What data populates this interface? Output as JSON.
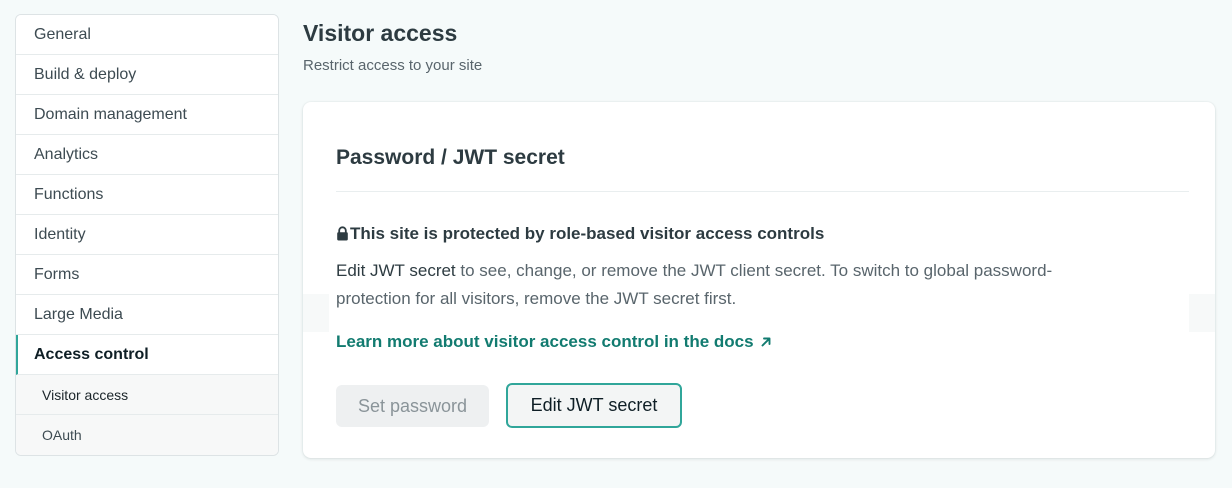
{
  "sidebar": {
    "items": [
      {
        "label": "General"
      },
      {
        "label": "Build & deploy"
      },
      {
        "label": "Domain management"
      },
      {
        "label": "Analytics"
      },
      {
        "label": "Functions"
      },
      {
        "label": "Identity"
      },
      {
        "label": "Forms"
      },
      {
        "label": "Large Media"
      },
      {
        "label": "Access control"
      }
    ],
    "subitems": [
      {
        "label": "Visitor access"
      },
      {
        "label": "OAuth"
      }
    ]
  },
  "header": {
    "title": "Visitor access",
    "subtitle": "Restrict access to your site"
  },
  "card": {
    "title": "Password / JWT secret",
    "notice_title": "This site is protected by role-based visitor access controls",
    "notice_body_strong": "Edit JWT secret",
    "notice_body_rest": " to see, change, or remove the JWT client secret. To switch to global password-protection for all visitors, remove the JWT secret first.",
    "docs_link": "Learn more about visitor access control in the docs",
    "buttons": {
      "set_password": "Set password",
      "edit_jwt": "Edit JWT secret"
    }
  },
  "icons": {
    "lock": "lock-icon",
    "external_link": "arrow-up-right-icon"
  },
  "colors": {
    "accent": "#30a69a",
    "link": "#127b70"
  }
}
